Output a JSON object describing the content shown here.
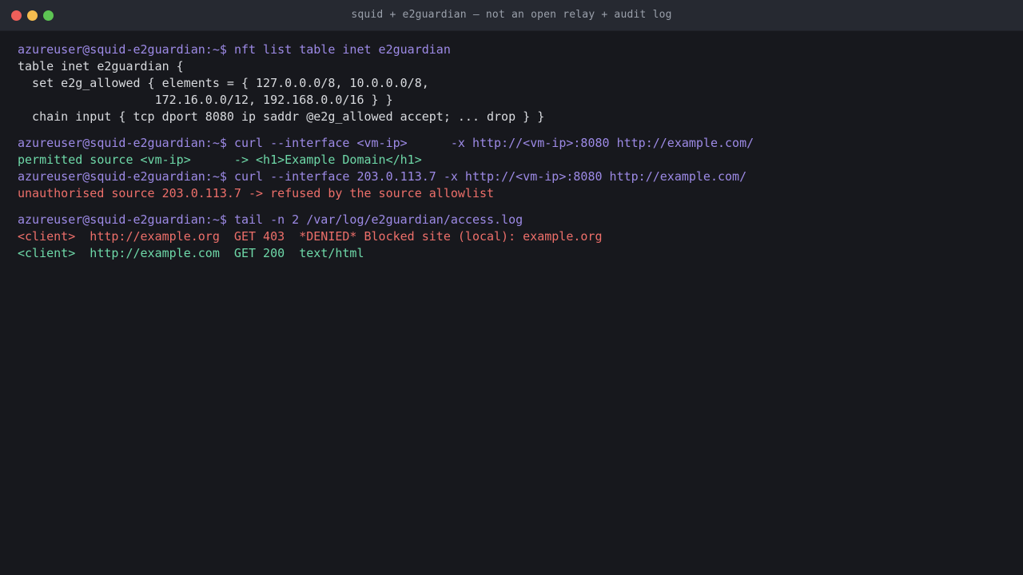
{
  "window": {
    "title": "squid + e2guardian — not an open relay + audit log"
  },
  "colors": {
    "prompt": "#9d8ae6",
    "success": "#6ed8a8",
    "error": "#ed6f6a",
    "plain": "#d8dade",
    "background": "#17181d",
    "titlebar": "#262931"
  },
  "terminal": {
    "prompt": "azureuser@squid-e2guardian:~$",
    "block1": {
      "command": "nft list table inet e2guardian",
      "output": [
        "table inet e2guardian {",
        "  set e2g_allowed { elements = { 127.0.0.0/8, 10.0.0.0/8,",
        "                   172.16.0.0/12, 192.168.0.0/16 } }",
        "  chain input { tcp dport 8080 ip saddr @e2g_allowed accept; ... drop } }"
      ]
    },
    "block2": {
      "command1": "curl --interface <vm-ip>      -x http://<vm-ip>:8080 http://example.com/",
      "output1": "permitted source <vm-ip>      -> <h1>Example Domain</h1>",
      "command2": "curl --interface 203.0.113.7 -x http://<vm-ip>:8080 http://example.com/",
      "output2": "unauthorised source 203.0.113.7 -> refused by the source allowlist"
    },
    "block3": {
      "command": "tail -n 2 /var/log/e2guardian/access.log",
      "log_denied": "<client>  http://example.org  GET 403  *DENIED* Blocked site (local): example.org",
      "log_allowed": "<client>  http://example.com  GET 200  text/html"
    }
  }
}
